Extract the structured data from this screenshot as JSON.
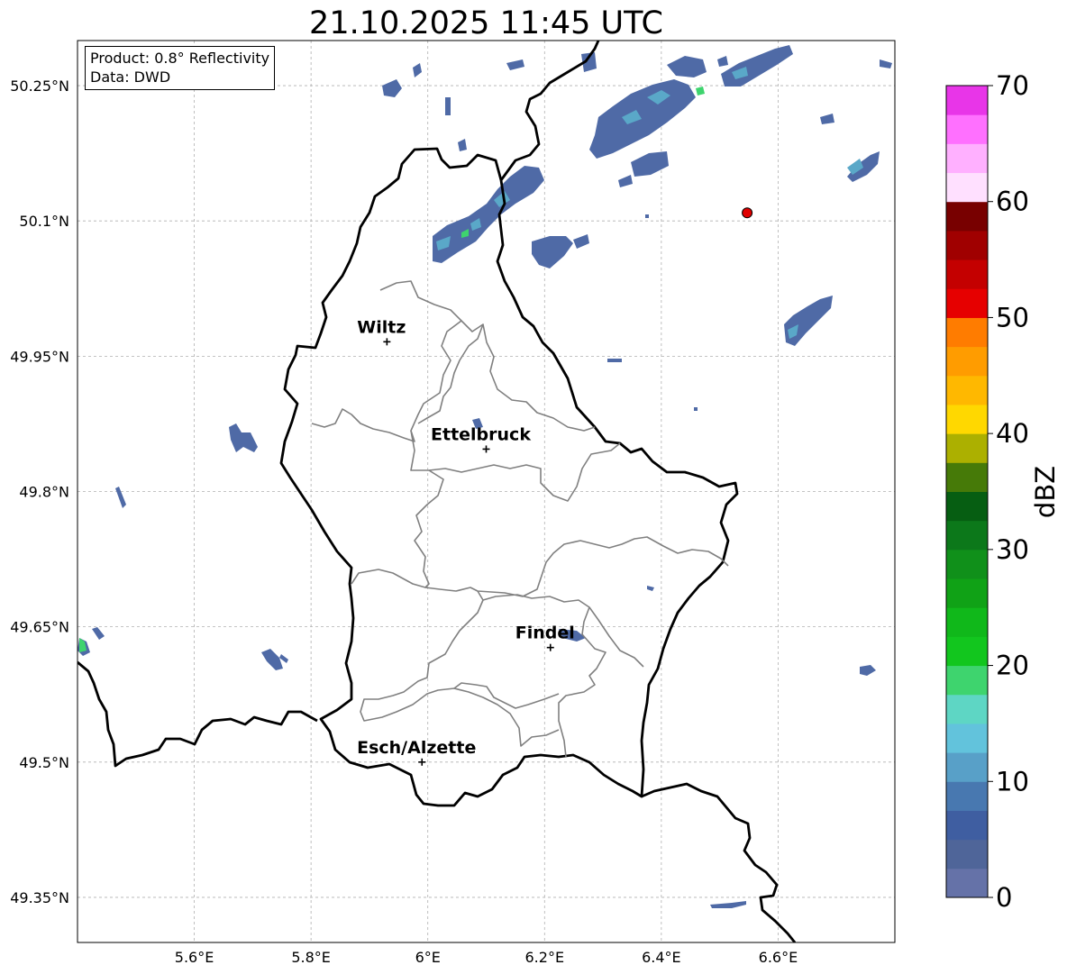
{
  "title": "21.10.2025 11:45 UTC",
  "info_box": {
    "product": "Product: 0.8° Reflectivity",
    "data_source": "Data: DWD"
  },
  "map": {
    "lon_range": [
      5.4,
      6.8
    ],
    "lat_range": [
      49.3,
      50.3
    ],
    "lon_ticks": [
      "5.6°E",
      "5.8°E",
      "6°E",
      "6.2°E",
      "6.4°E",
      "6.6°E"
    ],
    "lat_ticks": [
      "49.35°N",
      "49.5°N",
      "49.65°N",
      "49.8°N",
      "49.95°N",
      "50.1°N",
      "50.25°N"
    ],
    "grid": true,
    "cities": [
      {
        "name": "Wiltz",
        "lon": 5.93,
        "lat": 49.966
      },
      {
        "name": "Ettelbruck",
        "lon": 6.1,
        "lat": 49.847
      },
      {
        "name": "Findel",
        "lon": 6.21,
        "lat": 49.627
      },
      {
        "name": "Esch/Alzette",
        "lon": 5.99,
        "lat": 49.5
      }
    ],
    "radar_site_color": "#e00000",
    "radar_site": {
      "lon": 6.547,
      "lat": 50.109
    }
  },
  "colorbar": {
    "label": "dBZ",
    "ticks": [
      "0",
      "10",
      "20",
      "30",
      "40",
      "50",
      "60",
      "70"
    ],
    "colors": [
      "#6572a8",
      "#4f6599",
      "#3f5ea1",
      "#4878b0",
      "#58a0c8",
      "#62c3dc",
      "#5ed6c4",
      "#3ed46e",
      "#12c61e",
      "#10b81a",
      "#10a216",
      "#10901a",
      "#0c781a",
      "#065e12",
      "#467a08",
      "#acb000",
      "#ffd800",
      "#ffb800",
      "#ff9c00",
      "#ff7c00",
      "#e60000",
      "#c40000",
      "#a00000",
      "#780000",
      "#ffe0ff",
      "#ffb0ff",
      "#ff70ff",
      "#e835e8"
    ]
  }
}
